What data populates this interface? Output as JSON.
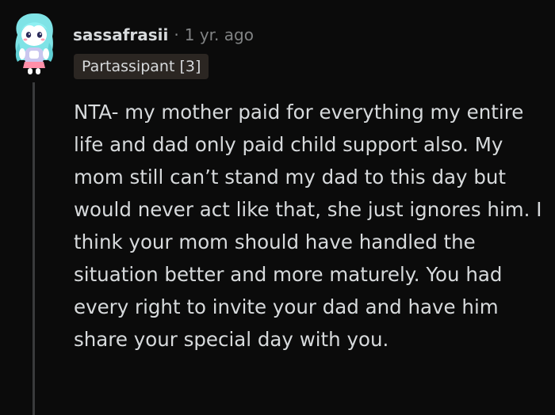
{
  "comment": {
    "username": "sassafrasii",
    "separator": "·",
    "timestamp": "1 yr. ago",
    "flair": "Partassipant [3]",
    "avatar_icon": "snoo-avatar-icon",
    "body": "NTA- my mother paid for everything my entire life and dad only paid child support also. My mom still can’t stand my dad to this day but would never act like that, she just ignores him. I think your mom should have handled the situation better and more maturely. You had every right to invite your dad and have him share your special day with you."
  },
  "colors": {
    "background": "#0b0b0b",
    "text": "#d7dadc",
    "muted": "#818384",
    "flair_bg": "#2b2622",
    "thread_line": "#3a3b3c"
  }
}
